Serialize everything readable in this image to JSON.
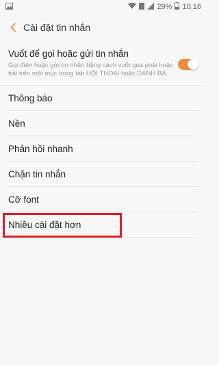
{
  "status": {
    "percent": "29%",
    "time": "10:16",
    "icons": [
      "image-icon",
      "wifi-icon",
      "data-icon",
      "signal-icon",
      "battery-icon"
    ]
  },
  "header": {
    "title": "Cài đặt tin nhắn"
  },
  "toggle_row": {
    "title": "Vuốt để gọi hoặc gửi tin nhắn",
    "subtitle": "Gọi điện hoặc gửi tin nhắn bằng cách vuốt qua phải hoặc trái trên một mục trong tab HỘI THOẠI hoặc DANH BẠ.",
    "enabled": true
  },
  "items": [
    {
      "label": "Thông báo"
    },
    {
      "label": "Nền"
    },
    {
      "label": "Phản hồi nhanh"
    },
    {
      "label": "Chặn tin nhắn"
    },
    {
      "label": "Cỡ font"
    },
    {
      "label": "Nhiều cài đặt hơn"
    }
  ],
  "colors": {
    "accent": "#f08a3c",
    "highlight": "#e21c24",
    "background": "#f7f7f7"
  }
}
